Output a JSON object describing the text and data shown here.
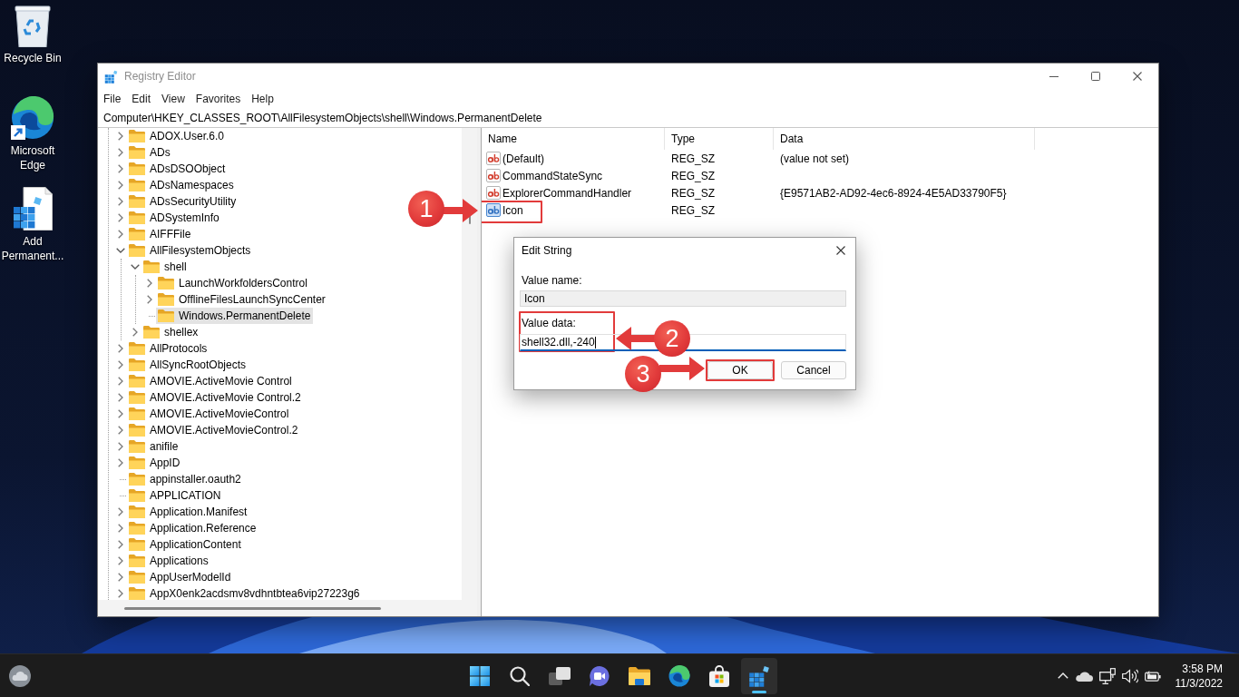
{
  "desktop": {
    "icons": [
      {
        "kind": "recycle-bin",
        "label": "Recycle Bin"
      },
      {
        "kind": "browser",
        "label": "Microsoft Edge"
      },
      {
        "kind": "registry-file",
        "label": "Add Permanent..."
      }
    ]
  },
  "window": {
    "title": "Registry Editor",
    "menu": [
      "File",
      "Edit",
      "View",
      "Favorites",
      "Help"
    ],
    "address": "Computer\\HKEY_CLASSES_ROOT\\AllFilesystemObjects\\shell\\Windows.PermanentDelete"
  },
  "tree": [
    {
      "label": "ADOX.User.6.0",
      "expandable": true,
      "expanded": false,
      "selected": false
    },
    {
      "label": "ADs",
      "expandable": true,
      "expanded": false,
      "selected": false
    },
    {
      "label": "ADsDSOObject",
      "expandable": true,
      "expanded": false,
      "selected": false
    },
    {
      "label": "ADsNamespaces",
      "expandable": true,
      "expanded": false,
      "selected": false
    },
    {
      "label": "ADsSecurityUtility",
      "expandable": true,
      "expanded": false,
      "selected": false
    },
    {
      "label": "ADSystemInfo",
      "expandable": true,
      "expanded": false,
      "selected": false
    },
    {
      "label": "AIFFFile",
      "expandable": true,
      "expanded": false,
      "selected": false
    },
    {
      "label": "AllFilesystemObjects",
      "expandable": true,
      "expanded": true,
      "selected": false,
      "children": [
        {
          "label": "shell",
          "expandable": true,
          "expanded": true,
          "selected": false,
          "children": [
            {
              "label": "LaunchWorkfoldersControl",
              "expandable": true,
              "expanded": false,
              "selected": false
            },
            {
              "label": "OfflineFilesLaunchSyncCenter",
              "expandable": true,
              "expanded": false,
              "selected": false
            },
            {
              "label": "Windows.PermanentDelete",
              "expandable": false,
              "selected": true
            }
          ]
        },
        {
          "label": "shellex",
          "expandable": true,
          "expanded": false,
          "selected": false
        }
      ]
    },
    {
      "label": "AllProtocols",
      "expandable": true,
      "expanded": false,
      "selected": false
    },
    {
      "label": "AllSyncRootObjects",
      "expandable": true,
      "expanded": false,
      "selected": false
    },
    {
      "label": "AMOVIE.ActiveMovie Control",
      "expandable": true,
      "expanded": false,
      "selected": false
    },
    {
      "label": "AMOVIE.ActiveMovie Control.2",
      "expandable": true,
      "expanded": false,
      "selected": false
    },
    {
      "label": "AMOVIE.ActiveMovieControl",
      "expandable": true,
      "expanded": false,
      "selected": false
    },
    {
      "label": "AMOVIE.ActiveMovieControl.2",
      "expandable": true,
      "expanded": false,
      "selected": false
    },
    {
      "label": "anifile",
      "expandable": true,
      "expanded": false,
      "selected": false
    },
    {
      "label": "AppID",
      "expandable": true,
      "expanded": false,
      "selected": false
    },
    {
      "label": "appinstaller.oauth2",
      "expandable": false,
      "selected": false
    },
    {
      "label": "APPLICATION",
      "expandable": false,
      "selected": false
    },
    {
      "label": "Application.Manifest",
      "expandable": true,
      "expanded": false,
      "selected": false
    },
    {
      "label": "Application.Reference",
      "expandable": true,
      "expanded": false,
      "selected": false
    },
    {
      "label": "ApplicationContent",
      "expandable": true,
      "expanded": false,
      "selected": false
    },
    {
      "label": "Applications",
      "expandable": true,
      "expanded": false,
      "selected": false
    },
    {
      "label": "AppUserModelId",
      "expandable": true,
      "expanded": false,
      "selected": false
    },
    {
      "label": "AppX0enk2acdsmv8vdhntbtea6vip27223g6",
      "expandable": true,
      "expanded": false,
      "selected": false
    }
  ],
  "values": {
    "columns": [
      "Name",
      "Type",
      "Data"
    ],
    "rows": [
      {
        "name": "(Default)",
        "type": "REG_SZ",
        "data": "(value not set)",
        "selected": false,
        "framed": false
      },
      {
        "name": "CommandStateSync",
        "type": "REG_SZ",
        "selected": false,
        "framed": false
      },
      {
        "name": "ExplorerCommandHandler",
        "type": "REG_SZ",
        "data": "{E9571AB2-AD92-4ec6-8924-4E5AD33790F5}",
        "selected": false,
        "framed": false
      },
      {
        "name": "Icon",
        "type": "REG_SZ",
        "selected": true,
        "framed": true
      }
    ]
  },
  "dialog": {
    "title": "Edit String",
    "fields": [
      {
        "kind": "readonly",
        "label": "Value name:",
        "value": "Icon",
        "focused": false,
        "framed": false
      },
      {
        "kind": "editable",
        "label": "Value data:",
        "value": "shell32.dll,-240",
        "focused": true,
        "framed": true
      }
    ],
    "buttons": [
      {
        "label": "OK",
        "framed": true
      },
      {
        "label": "Cancel",
        "framed": false
      }
    ]
  },
  "annotations": [
    {
      "number": "1",
      "kind": "arrow-right"
    },
    {
      "number": "2",
      "kind": "arrow-left"
    },
    {
      "number": "3",
      "kind": "arrow-right"
    }
  ],
  "taskbar": {
    "apps": [
      {
        "kind": "start",
        "active": false
      },
      {
        "kind": "search",
        "active": false
      },
      {
        "kind": "task-view",
        "active": false
      },
      {
        "kind": "chat",
        "active": false
      },
      {
        "kind": "explorer",
        "active": false
      },
      {
        "kind": "browser",
        "active": false
      },
      {
        "kind": "store",
        "active": false
      },
      {
        "kind": "registry",
        "active": true
      }
    ],
    "time": "3:58 PM",
    "date": "11/3/2022"
  }
}
